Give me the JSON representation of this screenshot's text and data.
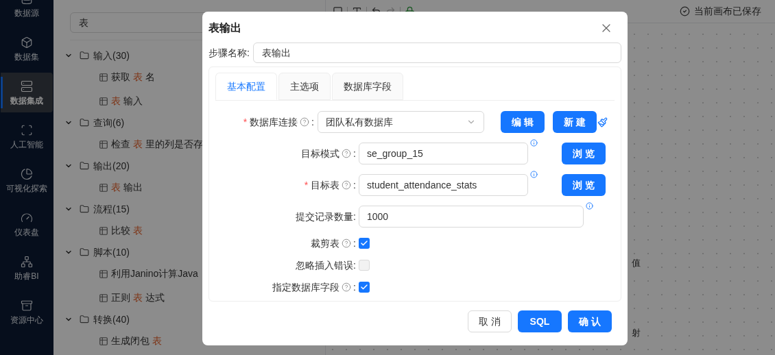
{
  "sidebar": {
    "items": [
      {
        "label": "数据源",
        "selected": false
      },
      {
        "label": "数据集",
        "selected": false
      },
      {
        "label": "数据集成",
        "selected": true
      },
      {
        "label": "人工智能",
        "selected": false
      },
      {
        "label": "可视化探索",
        "selected": false
      },
      {
        "label": "仪表盘",
        "selected": false
      },
      {
        "label": "助睿BI",
        "selected": false
      },
      {
        "label": "资源中心",
        "selected": false
      }
    ]
  },
  "tree": {
    "search": {
      "value": "表"
    },
    "groups": [
      {
        "label": "输入(30)",
        "expanded": true,
        "children": [
          {
            "parts": [
              {
                "text": "获取 ",
                "match": false
              },
              {
                "text": "表",
                "match": true
              },
              {
                "text": " 名",
                "match": false
              }
            ]
          },
          {
            "parts": [
              {
                "text": "表",
                "match": true
              },
              {
                "text": " 输入",
                "match": false
              }
            ]
          }
        ]
      },
      {
        "label": "查询(6)",
        "expanded": true,
        "children": [
          {
            "parts": [
              {
                "text": "检查 ",
                "match": false
              },
              {
                "text": "表",
                "match": true
              },
              {
                "text": " 里的列是否存",
                "match": false
              }
            ]
          }
        ]
      },
      {
        "label": "输出(20)",
        "expanded": true,
        "children": [
          {
            "parts": [
              {
                "text": "表",
                "match": true
              },
              {
                "text": " 输出",
                "match": false
              }
            ]
          }
        ]
      },
      {
        "label": "流程(15)",
        "expanded": true,
        "children": [
          {
            "parts": [
              {
                "text": "比较 ",
                "match": false
              },
              {
                "text": "表",
                "match": true
              }
            ]
          }
        ]
      },
      {
        "label": "脚本(10)",
        "expanded": true,
        "children": [
          {
            "parts": [
              {
                "text": "利用Janino计算Java ",
                "match": false
              }
            ]
          },
          {
            "parts": [
              {
                "text": "正则 ",
                "match": false
              },
              {
                "text": "表",
                "match": true
              },
              {
                "text": " 达式",
                "match": false
              }
            ]
          }
        ]
      },
      {
        "label": "转换(40)",
        "expanded": true,
        "children": [
          {
            "parts": [
              {
                "text": "生成闭包 ",
                "match": false
              },
              {
                "text": "表",
                "match": true
              }
            ]
          }
        ]
      }
    ]
  },
  "canvas": {
    "status": "当前画布已保存",
    "labels": [
      "值",
      "射"
    ]
  },
  "dialog": {
    "title": "表输出",
    "step_name": {
      "label": "步骤名称:",
      "value": "表输出"
    },
    "label_suffix": ":",
    "required_mark": "*",
    "tabs": [
      {
        "label": "基本配置",
        "selected": true
      },
      {
        "label": "主选项",
        "selected": false
      },
      {
        "label": "数据库字段",
        "selected": false
      }
    ],
    "rows": [
      {
        "kind": "select",
        "label": "数据库连接",
        "required": true,
        "help": true,
        "value": "团队私有数据库",
        "buttons": [
          "编 辑",
          "新 建"
        ]
      },
      {
        "kind": "text",
        "label": "目标模式",
        "required": false,
        "help": true,
        "value": "se_group_15",
        "info": true,
        "wide": false,
        "buttons": [
          "浏 览"
        ]
      },
      {
        "kind": "text",
        "label": "目标表",
        "required": true,
        "help": true,
        "value": "student_attendance_stats",
        "info": true,
        "wide": false,
        "buttons": [
          "浏 览"
        ]
      },
      {
        "kind": "text",
        "label": "提交记录数量",
        "required": false,
        "help": false,
        "value": "1000",
        "info": true,
        "wide": true,
        "buttons": []
      },
      {
        "kind": "checkbox",
        "label": "裁剪表",
        "required": false,
        "help": true,
        "checked": true
      },
      {
        "kind": "checkbox",
        "label": "忽略插入错误",
        "required": false,
        "help": false,
        "checked": false
      },
      {
        "kind": "checkbox",
        "label": "指定数据库字段",
        "required": false,
        "help": true,
        "checked": true
      }
    ],
    "footer": [
      {
        "label": "取 消",
        "primary": false
      },
      {
        "label": "SQL",
        "primary": true
      },
      {
        "label": "确 认",
        "primary": true
      }
    ]
  }
}
